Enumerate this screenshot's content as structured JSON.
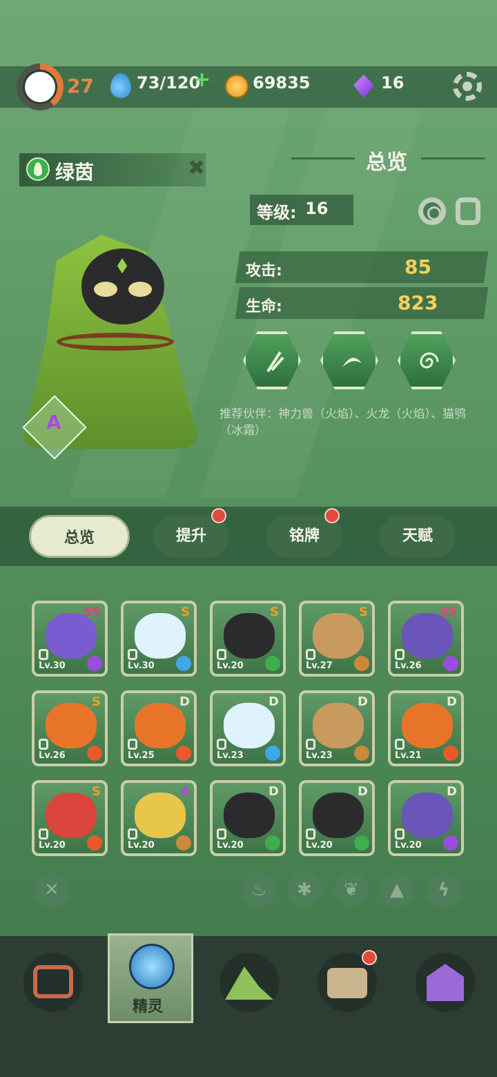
{
  "status": {
    "player_level": "27",
    "energy": "73/120",
    "coins": "69835",
    "gems": "16"
  },
  "character": {
    "name": "绿茵",
    "rank": "A"
  },
  "overview": {
    "title": "总览",
    "level_label": "等级:",
    "level_value": "16",
    "attack_label": "攻击:",
    "attack_value": "85",
    "hp_label": "生命:",
    "hp_value": "823",
    "recommend": "推荐伙伴：神力兽（火焰）、火龙（火焰）、猫鸮（冰霜）"
  },
  "tabs": [
    {
      "label": "总览",
      "active": true,
      "badge": false
    },
    {
      "label": "提升",
      "active": false,
      "badge": true
    },
    {
      "label": "铭牌",
      "active": false,
      "badge": true
    },
    {
      "label": "天赋",
      "active": false,
      "badge": false
    }
  ],
  "cards": [
    {
      "rank": "SS",
      "level": "Lv.30",
      "element": "lightning",
      "color": "#7b5bd1"
    },
    {
      "rank": "S",
      "level": "Lv.30",
      "element": "ice",
      "color": "#dff3ff"
    },
    {
      "rank": "S",
      "level": "Lv.20",
      "element": "grass",
      "color": "#2b2b2e"
    },
    {
      "rank": "S",
      "level": "Lv.27",
      "element": "earth",
      "color": "#c99a5e"
    },
    {
      "rank": "SS",
      "level": "Lv.26",
      "element": "lightning",
      "color": "#6a55b8"
    },
    {
      "rank": "S",
      "level": "Lv.26",
      "element": "fire",
      "color": "#e8742a"
    },
    {
      "rank": "D",
      "level": "Lv.25",
      "element": "fire",
      "color": "#e8742a"
    },
    {
      "rank": "D",
      "level": "Lv.23",
      "element": "ice",
      "color": "#dff3ff"
    },
    {
      "rank": "D",
      "level": "Lv.23",
      "element": "earth",
      "color": "#c99a5e"
    },
    {
      "rank": "D",
      "level": "Lv.21",
      "element": "fire",
      "color": "#e8742a"
    },
    {
      "rank": "S",
      "level": "Lv.20",
      "element": "fire",
      "color": "#d9443c"
    },
    {
      "rank": "A",
      "level": "Lv.20",
      "element": "earth",
      "color": "#e8c64a"
    },
    {
      "rank": "D",
      "level": "Lv.20",
      "element": "grass",
      "color": "#2b2b2e"
    },
    {
      "rank": "D",
      "level": "Lv.20",
      "element": "grass",
      "color": "#2b2b2e"
    },
    {
      "rank": "D",
      "level": "Lv.20",
      "element": "lightning",
      "color": "#6a55b8"
    }
  ],
  "filters": [
    "clear",
    "fire",
    "ice",
    "grass",
    "earth",
    "lightning"
  ],
  "bottom_nav": {
    "active_label": "精灵"
  },
  "colors": {
    "rank_SS": "#e04080",
    "rank_S": "#f0a020",
    "rank_A": "#a64de0",
    "rank_D": "#e8e8d8",
    "stat_value": "#f2d25a"
  }
}
